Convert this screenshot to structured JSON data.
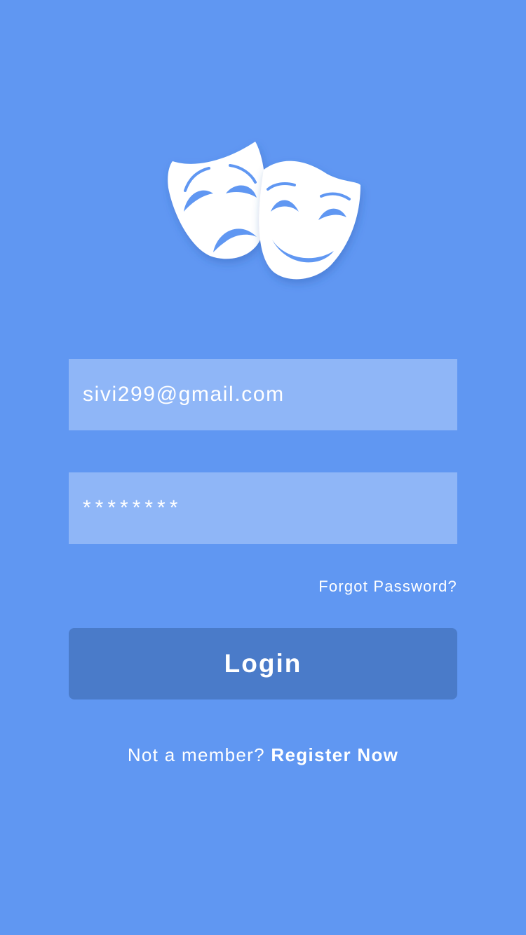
{
  "colors": {
    "background": "#6097f2",
    "field_background": "#8fb6f7",
    "button_background": "#4a7bc9",
    "text": "#ffffff"
  },
  "logo": {
    "icon": "theater-masks-icon"
  },
  "login_form": {
    "email_value": "sivi299@gmail.com",
    "password_value": "********",
    "forgot_password_label": "Forgot Password?",
    "login_label": "Login"
  },
  "register": {
    "prompt": "Not a member?",
    "link_label": "Register Now"
  }
}
